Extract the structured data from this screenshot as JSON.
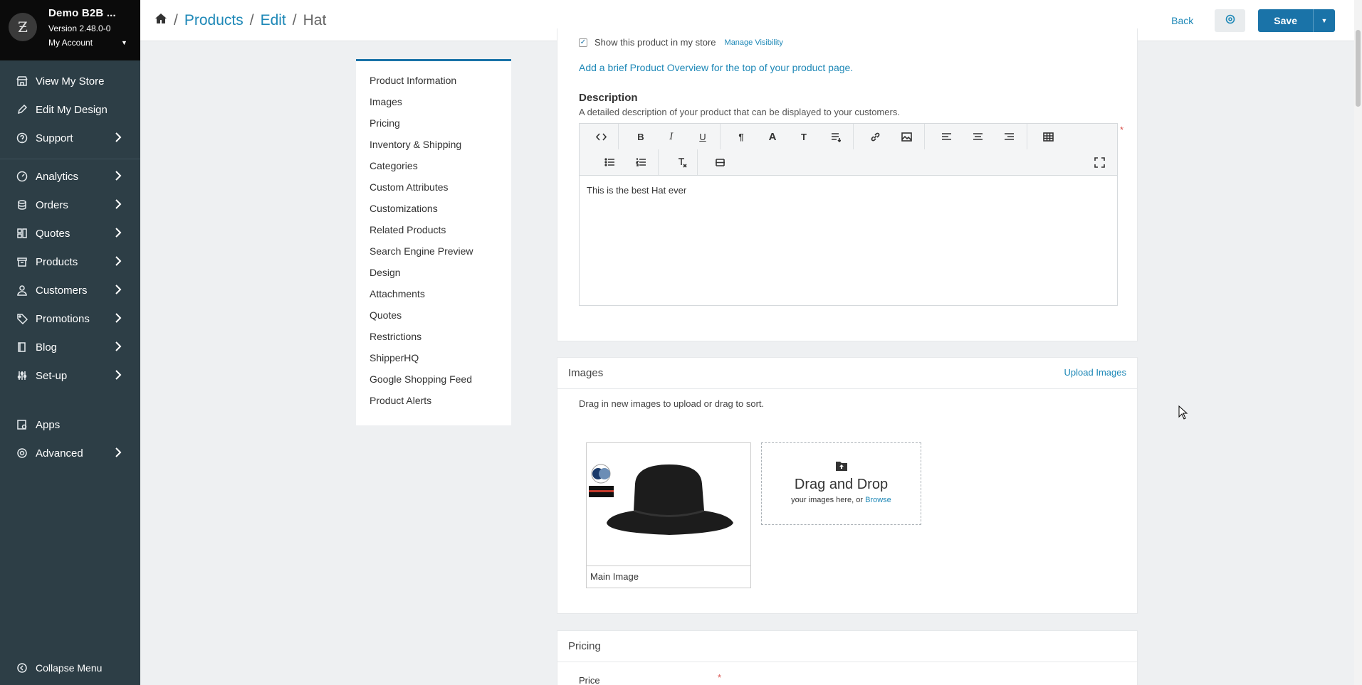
{
  "sidebar": {
    "store_name": "Demo B2B ...",
    "version": "Version 2.48.0-0",
    "account": "My Account",
    "items": [
      {
        "label": "View My Store",
        "icon": "store-icon"
      },
      {
        "label": "Edit My Design",
        "icon": "pencil-icon"
      },
      {
        "label": "Support",
        "icon": "help-circle-icon",
        "chevron": true
      },
      {
        "label": "Analytics",
        "icon": "analytics-icon",
        "chevron": true
      },
      {
        "label": "Orders",
        "icon": "orders-icon",
        "chevron": true
      },
      {
        "label": "Quotes",
        "icon": "quotes-icon",
        "chevron": true
      },
      {
        "label": "Products",
        "icon": "box-icon",
        "chevron": true
      },
      {
        "label": "Customers",
        "icon": "user-icon",
        "chevron": true
      },
      {
        "label": "Promotions",
        "icon": "tag-icon",
        "chevron": true
      },
      {
        "label": "Blog",
        "icon": "book-icon",
        "chevron": true
      },
      {
        "label": "Set-up",
        "icon": "sliders-icon",
        "chevron": true
      },
      {
        "label": "Apps",
        "icon": "apps-icon"
      },
      {
        "label": "Advanced",
        "icon": "gear-icon",
        "chevron": true
      }
    ],
    "collapse": "Collapse Menu"
  },
  "breadcrumb": {
    "products": "Products",
    "edit": "Edit",
    "current": "Hat",
    "sep": "/"
  },
  "top_actions": {
    "back": "Back",
    "save": "Save"
  },
  "section_nav": [
    "Product Information",
    "Images",
    "Pricing",
    "Inventory & Shipping",
    "Categories",
    "Custom Attributes",
    "Customizations",
    "Related Products",
    "Search Engine Preview",
    "Design",
    "Attachments",
    "Quotes",
    "Restrictions",
    "ShipperHQ",
    "Google Shopping Feed",
    "Product Alerts"
  ],
  "product_info": {
    "visibility_label": "Show this product in my store",
    "manage_visibility": "Manage Visibility",
    "overview_link": "Add a brief Product Overview for the top of your product page.",
    "description_title": "Description",
    "description_help": "A detailed description of your product that can be displayed to your customers.",
    "required_mark": "*",
    "editor_content": "This is the best Hat ever"
  },
  "images": {
    "title": "Images",
    "upload_link": "Upload Images",
    "help": "Drag in new images to upload or drag to sort.",
    "main_caption": "Main Image",
    "dropzone_title": "Drag and Drop",
    "dropzone_sub": "your images here, or",
    "browse": "Browse"
  },
  "pricing": {
    "title": "Pricing",
    "price_label": "Price",
    "required_mark": "*"
  },
  "colors": {
    "sidebar_bg": "#2d3e46",
    "accent": "#1a73a8",
    "link": "#1e88b7"
  }
}
